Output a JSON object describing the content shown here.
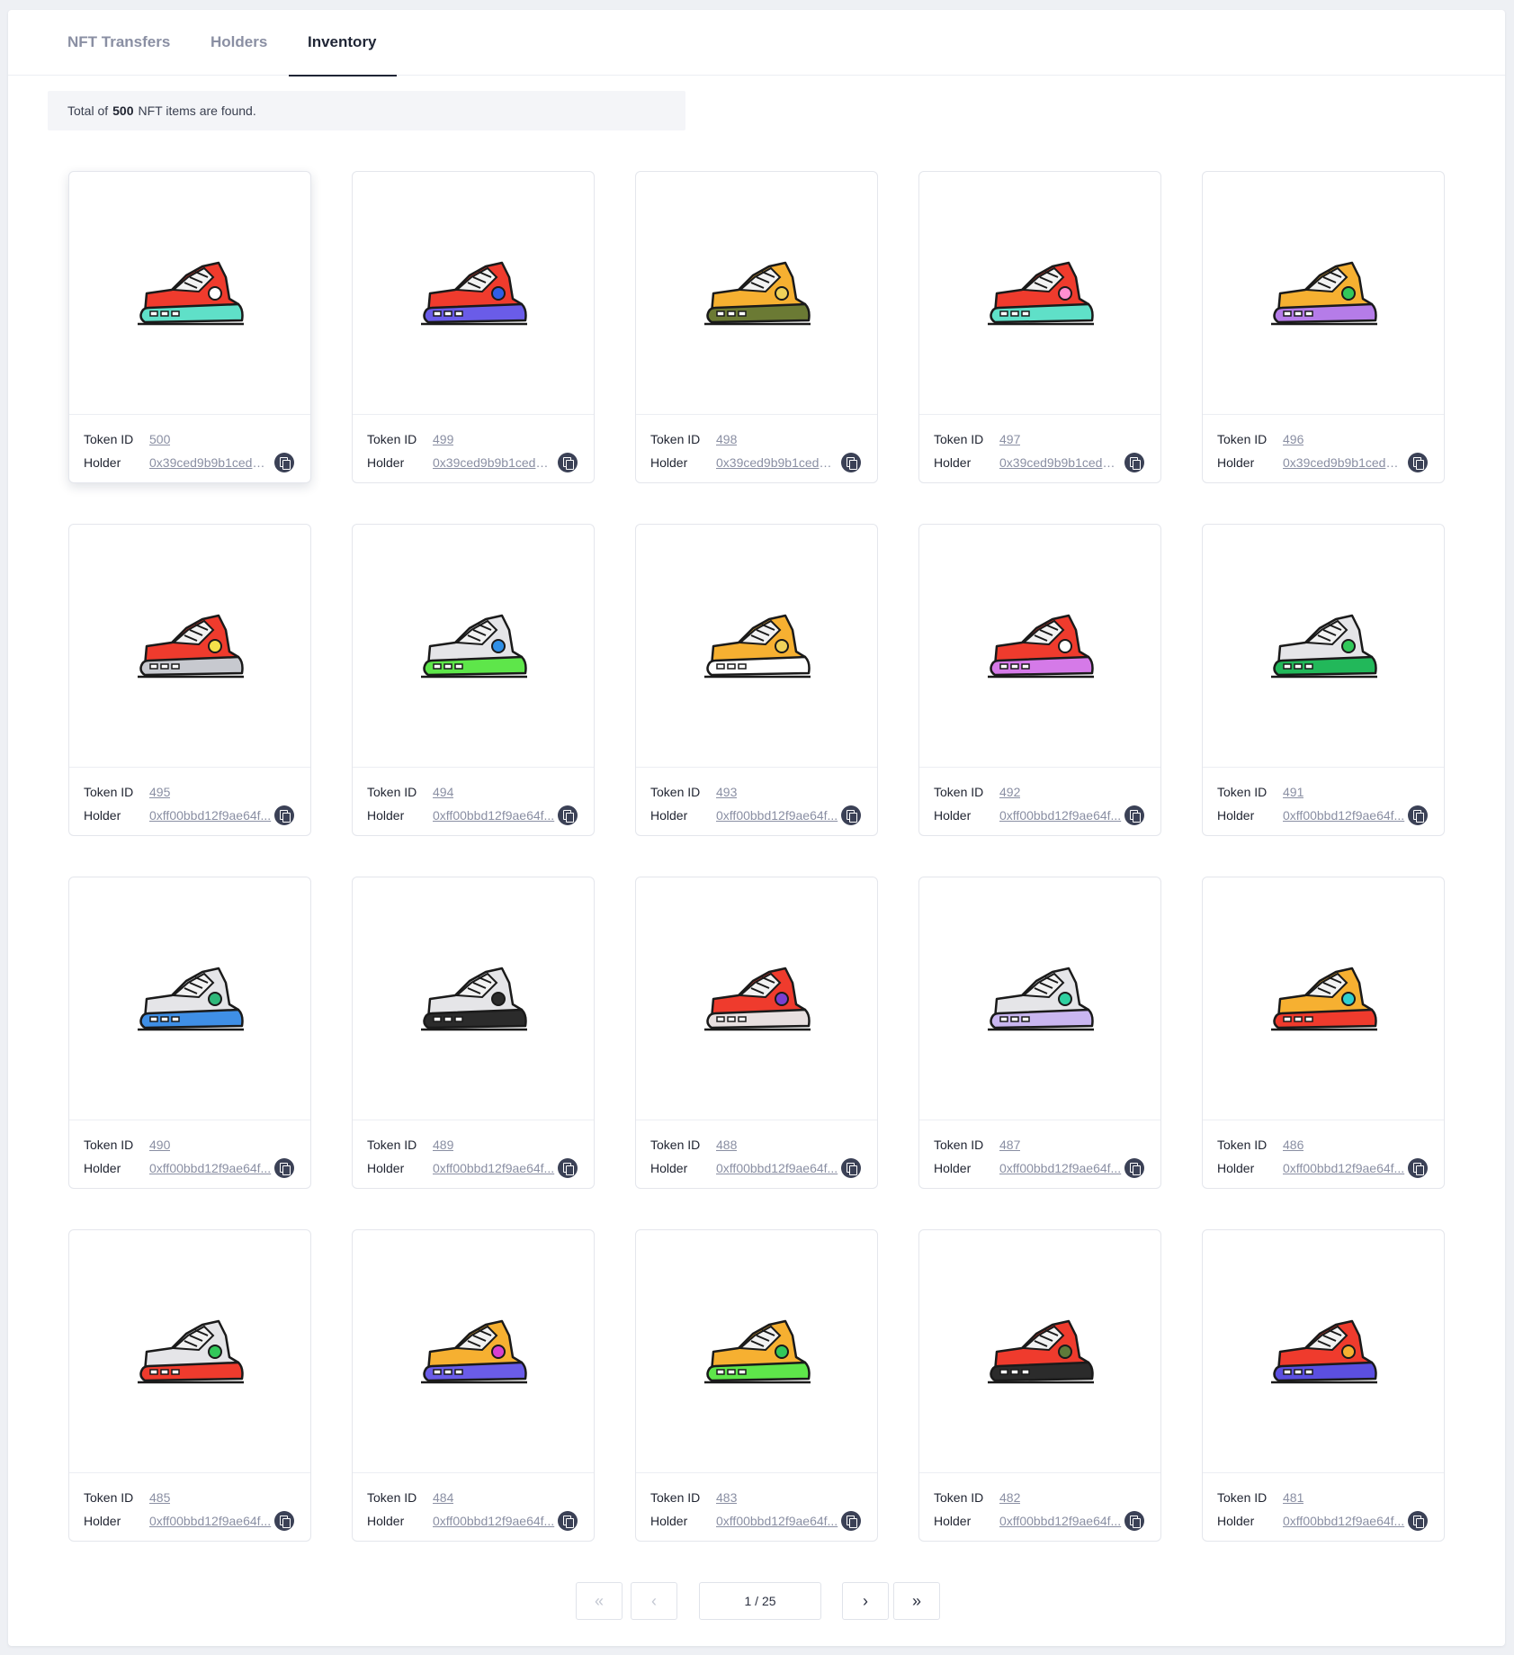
{
  "tabs": [
    {
      "label": "NFT Transfers"
    },
    {
      "label": "Holders"
    },
    {
      "label": "Inventory"
    }
  ],
  "active_tab": "Inventory",
  "summary": {
    "prefix": "Total of",
    "count": "500",
    "suffix": "NFT items are found."
  },
  "card_labels": {
    "token": "Token ID",
    "holder": "Holder"
  },
  "items": [
    {
      "token_id": "500",
      "holder": "0x39ced9b9b1cedb6...",
      "colors": {
        "upper": "#ef3b2d",
        "accent": "#ffffff",
        "sole": "#5fe0c8"
      }
    },
    {
      "token_id": "499",
      "holder": "0x39ced9b9b1cedb6...",
      "colors": {
        "upper": "#ef3b2d",
        "accent": "#2f5ee6",
        "sole": "#6a5ce8"
      }
    },
    {
      "token_id": "498",
      "holder": "0x39ced9b9b1cedb6...",
      "colors": {
        "upper": "#f6b031",
        "accent": "#f0d25a",
        "sole": "#6b7a34"
      }
    },
    {
      "token_id": "497",
      "holder": "0x39ced9b9b1cedb6...",
      "colors": {
        "upper": "#ef3b2d",
        "accent": "#ff8fd0",
        "sole": "#5fe0c8"
      }
    },
    {
      "token_id": "496",
      "holder": "0x39ced9b9b1cedb6...",
      "colors": {
        "upper": "#f6b031",
        "accent": "#32c85a",
        "sole": "#b57ce8"
      }
    },
    {
      "token_id": "495",
      "holder": "0xff00bbd12f9ae64f...",
      "colors": {
        "upper": "#ef3b2d",
        "accent": "#f6e04a",
        "sole": "#c7c9cf"
      }
    },
    {
      "token_id": "494",
      "holder": "0xff00bbd12f9ae64f...",
      "colors": {
        "upper": "#e5e5e8",
        "accent": "#2f8fe6",
        "sole": "#5ee64a"
      }
    },
    {
      "token_id": "493",
      "holder": "0xff00bbd12f9ae64f...",
      "colors": {
        "upper": "#f6b031",
        "accent": "#f0d25a",
        "sole": "#ffffff"
      }
    },
    {
      "token_id": "492",
      "holder": "0xff00bbd12f9ae64f...",
      "colors": {
        "upper": "#ef3b2d",
        "accent": "#ffffff",
        "sole": "#d57ae8"
      }
    },
    {
      "token_id": "491",
      "holder": "0xff00bbd12f9ae64f...",
      "colors": {
        "upper": "#e5e5e8",
        "accent": "#32c85a",
        "sole": "#22b85a"
      }
    },
    {
      "token_id": "490",
      "holder": "0xff00bbd12f9ae64f...",
      "colors": {
        "upper": "#e5e5e8",
        "accent": "#2fb87a",
        "sole": "#3f8fe6"
      }
    },
    {
      "token_id": "489",
      "holder": "0xff00bbd12f9ae64f...",
      "colors": {
        "upper": "#e5e5e8",
        "accent": "#2b2b2b",
        "sole": "#2b2b2b"
      }
    },
    {
      "token_id": "488",
      "holder": "0xff00bbd12f9ae64f...",
      "colors": {
        "upper": "#ef3b2d",
        "accent": "#7a3fd0",
        "sole": "#e8e0e0"
      }
    },
    {
      "token_id": "487",
      "holder": "0xff00bbd12f9ae64f...",
      "colors": {
        "upper": "#e5e5e8",
        "accent": "#2fd0a0",
        "sole": "#c9b6f0"
      }
    },
    {
      "token_id": "486",
      "holder": "0xff00bbd12f9ae64f...",
      "colors": {
        "upper": "#f6b031",
        "accent": "#2fd0d0",
        "sole": "#ef3b2d"
      }
    },
    {
      "token_id": "485",
      "holder": "0xff00bbd12f9ae64f...",
      "colors": {
        "upper": "#e5e5e8",
        "accent": "#32c85a",
        "sole": "#ef3b2d"
      }
    },
    {
      "token_id": "484",
      "holder": "0xff00bbd12f9ae64f...",
      "colors": {
        "upper": "#f6b031",
        "accent": "#d83fd0",
        "sole": "#6a5ce8"
      }
    },
    {
      "token_id": "483",
      "holder": "0xff00bbd12f9ae64f...",
      "colors": {
        "upper": "#f6b031",
        "accent": "#32c85a",
        "sole": "#5ee64a"
      }
    },
    {
      "token_id": "482",
      "holder": "0xff00bbd12f9ae64f...",
      "colors": {
        "upper": "#ef3b2d",
        "accent": "#5f7a3a",
        "sole": "#2b2b2b"
      }
    },
    {
      "token_id": "481",
      "holder": "0xff00bbd12f9ae64f...",
      "colors": {
        "upper": "#ef3b2d",
        "accent": "#f6b031",
        "sole": "#5b4fe0"
      }
    }
  ],
  "pagination": {
    "first_icon": "double-chevron-left-icon",
    "prev_icon": "chevron-left-icon",
    "indicator": "1 / 25",
    "next_icon": "chevron-right-icon",
    "last_icon": "double-chevron-right-icon"
  }
}
